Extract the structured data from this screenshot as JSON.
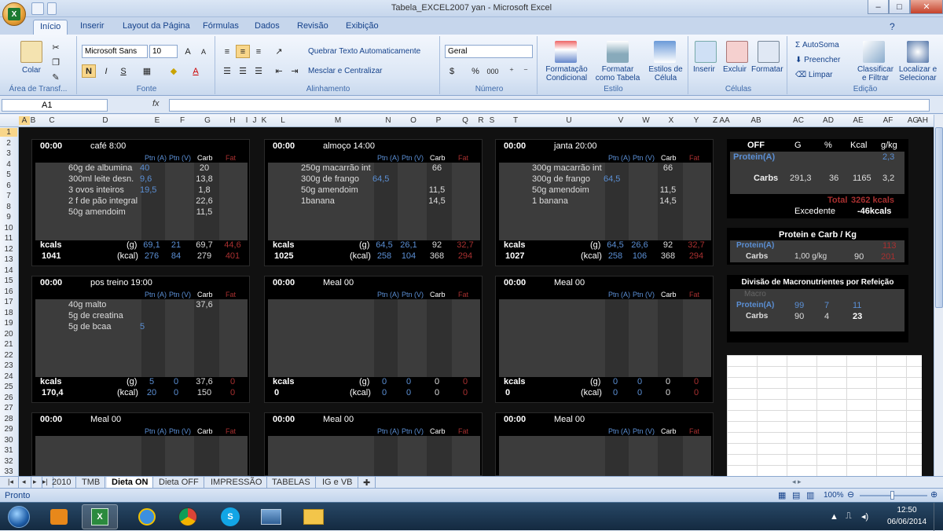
{
  "window": {
    "title": "Tabela_EXCEL2007 yan - Microsoft Excel",
    "logo_letter": "X"
  },
  "ribbon_tabs": [
    "Início",
    "Inserir",
    "Layout da Página",
    "Fórmulas",
    "Dados",
    "Revisão",
    "Exibição"
  ],
  "ribbon": {
    "clipboard": {
      "label": "Área de Transf...",
      "paste": "Colar"
    },
    "font": {
      "label": "Fonte",
      "name": "Microsoft Sans",
      "size": "10",
      "bold": "N",
      "italic": "I",
      "underline": "S"
    },
    "alignment": {
      "label": "Alinhamento",
      "wrap": "Quebrar Texto Automaticamente",
      "merge": "Mesclar e Centralizar"
    },
    "number": {
      "label": "Número",
      "format": "Geral",
      "percent": "%",
      "thousands": "000"
    },
    "styles": {
      "label": "Estilo",
      "cond": [
        "Formatação",
        "Condicional"
      ],
      "table": [
        "Formatar",
        "como Tabela"
      ],
      "cell": [
        "Estilos de",
        "Célula"
      ]
    },
    "cells": {
      "label": "Células",
      "insert": "Inserir",
      "delete": "Excluir",
      "format": "Formatar"
    },
    "editing": {
      "label": "Edição",
      "autosum": "AutoSoma",
      "fill": "Preencher",
      "clear": "Limpar",
      "sort": [
        "Classificar",
        "e Filtrar"
      ],
      "find": [
        "Localizar e",
        "Selecionar"
      ]
    }
  },
  "formula_bar": {
    "name_box": "A1",
    "fx": "fx"
  },
  "columns": [
    "A",
    "B",
    "C",
    "D",
    "E",
    "F",
    "G",
    "H",
    "I",
    "J",
    "K",
    "L",
    "M",
    "N",
    "O",
    "P",
    "Q",
    "R",
    "S",
    "T",
    "U",
    "V",
    "W",
    "X",
    "Y",
    "Z",
    "AA",
    "AB",
    "AC",
    "AD",
    "AE",
    "AF",
    "AG",
    "AH",
    "AI",
    "AJ"
  ],
  "rows": [
    "1",
    "2",
    "3",
    "4",
    "5",
    "6",
    "7",
    "8",
    "9",
    "10",
    "11",
    "12",
    "13",
    "14",
    "15",
    "16",
    "17",
    "18",
    "19",
    "20",
    "21",
    "22",
    "23",
    "24",
    "25",
    "26",
    "27",
    "28",
    "29",
    "30",
    "31",
    "32",
    "33"
  ],
  "col_headers_meal": [
    "Ptn (A)",
    "Ptn (V)",
    "Carb",
    "Fat"
  ],
  "meals": [
    {
      "time": "00:00",
      "name": "café 8:00",
      "items": [
        [
          "60g de albumina",
          "40",
          "",
          "20",
          ""
        ],
        [
          "300ml leite desn.",
          "9,6",
          "",
          "13,8",
          ""
        ],
        [
          "3 ovos  inteiros",
          "19,5",
          "",
          "1,8",
          ""
        ],
        [
          "2 f de pão integral",
          "",
          "",
          "22,6",
          ""
        ],
        [
          "50g amendoim",
          "",
          "",
          "11,5",
          ""
        ]
      ],
      "kcals_label": "kcals",
      "kcals": "1041",
      "g_label": "(g)",
      "kcal_label": "(kcal)",
      "g": [
        "69,1",
        "21",
        "69,7",
        "44,6"
      ],
      "kcal": [
        "276",
        "84",
        "279",
        "401"
      ]
    },
    {
      "time": "00:00",
      "name": "almoço 14:00",
      "items": [
        [
          "250g macarrão int",
          "",
          "",
          "66",
          ""
        ],
        [
          "300g de frango",
          "64,5",
          "",
          "",
          ""
        ],
        [
          "50g amendoim",
          "",
          "",
          "11,5",
          ""
        ],
        [
          "1banana",
          "",
          "",
          "14,5",
          ""
        ]
      ],
      "kcals_label": "kcals",
      "kcals": "1025",
      "g_label": "(g)",
      "kcal_label": "(kcal)",
      "g": [
        "64,5",
        "26,1",
        "92",
        "32,7"
      ],
      "kcal": [
        "258",
        "104",
        "368",
        "294"
      ]
    },
    {
      "time": "00:00",
      "name": "janta 20:00",
      "items": [
        [
          "300g macarrão int",
          "",
          "",
          "66",
          ""
        ],
        [
          "300g de frango",
          "64,5",
          "",
          "",
          ""
        ],
        [
          "50g amendoim",
          "",
          "",
          "11,5",
          ""
        ],
        [
          "1 banana",
          "",
          "",
          "14,5",
          ""
        ]
      ],
      "kcals_label": "kcals",
      "kcals": "1027",
      "g_label": "(g)",
      "kcal_label": "(kcal)",
      "g": [
        "64,5",
        "26,6",
        "92",
        "32,7"
      ],
      "kcal": [
        "258",
        "106",
        "368",
        "294"
      ]
    },
    {
      "time": "00:00",
      "name": "pos treino 19:00",
      "items": [
        [
          "40g malto",
          "",
          "",
          "37,6",
          ""
        ],
        [
          "5g de creatina",
          "",
          "",
          "",
          ""
        ],
        [
          "5g de bcaa",
          "5",
          "",
          "",
          ""
        ]
      ],
      "kcals_label": "kcals",
      "kcals": "170,4",
      "g_label": "(g)",
      "kcal_label": "(kcal)",
      "g": [
        "5",
        "0",
        "37,6",
        "0"
      ],
      "kcal": [
        "20",
        "0",
        "150",
        "0"
      ]
    },
    {
      "time": "00:00",
      "name": "Meal 00",
      "items": [],
      "kcals_label": "kcals",
      "kcals": "0",
      "g_label": "(g)",
      "kcal_label": "(kcal)",
      "g": [
        "0",
        "0",
        "0",
        "0"
      ],
      "kcal": [
        "0",
        "0",
        "0",
        "0"
      ]
    },
    {
      "time": "00:00",
      "name": "Meal 00",
      "items": [],
      "kcals_label": "kcals",
      "kcals": "0",
      "g_label": "(g)",
      "kcal_label": "(kcal)",
      "g": [
        "0",
        "0",
        "0",
        "0"
      ],
      "kcal": [
        "0",
        "0",
        "0",
        "0"
      ]
    },
    {
      "time": "00:00",
      "name": "Meal 00",
      "items": []
    },
    {
      "time": "00:00",
      "name": "Meal 00",
      "items": []
    },
    {
      "time": "00:00",
      "name": "Meal 00",
      "items": []
    }
  ],
  "summary": {
    "headers": [
      "OFF",
      "G",
      "%",
      "Kcal",
      "g/kg"
    ],
    "protein_label": "Protein(A)",
    "protein_gkg": "2,3",
    "carbs": [
      "Carbs",
      "291,3",
      "36",
      "1165",
      "3,2"
    ],
    "total_label": "Total",
    "total_value": "3262 kcals",
    "excedente_label": "Excedente",
    "excedente_value": "-46kcals"
  },
  "protein_carb": {
    "title": "Protein e Carb / Kg",
    "protein_label": "Protein(A)",
    "protein_value": "113",
    "carbs_label": "Carbs",
    "carbs_gkg": "1,00",
    "carbs_unit": "g/kg",
    "carbs_g": "90",
    "carbs_kcal": "201"
  },
  "division": {
    "title": "Divisão de Macronutrientes por Refeição",
    "macro_label": "Macro",
    "protein_label": "Protein(A)",
    "protein_values": [
      "99",
      "7",
      "11"
    ],
    "carbs_label": "Carbs",
    "carbs_values": [
      "90",
      "4",
      "23"
    ]
  },
  "sheet_tabs": [
    "2010",
    "TMB",
    "Dieta ON",
    "Dieta OFF",
    "IMPRESSÃO",
    "TABELAS",
    "IG e VB"
  ],
  "active_sheet": "Dieta ON",
  "status": {
    "mode": "Pronto",
    "zoom": "100%"
  },
  "taskbar": {
    "time": "12:50",
    "date": "06/06/2014"
  },
  "colors": {
    "accent": "#15428b",
    "blue_value": "#5b8fd4",
    "red_value": "#a83030",
    "excel_green": "#1d7a30"
  }
}
